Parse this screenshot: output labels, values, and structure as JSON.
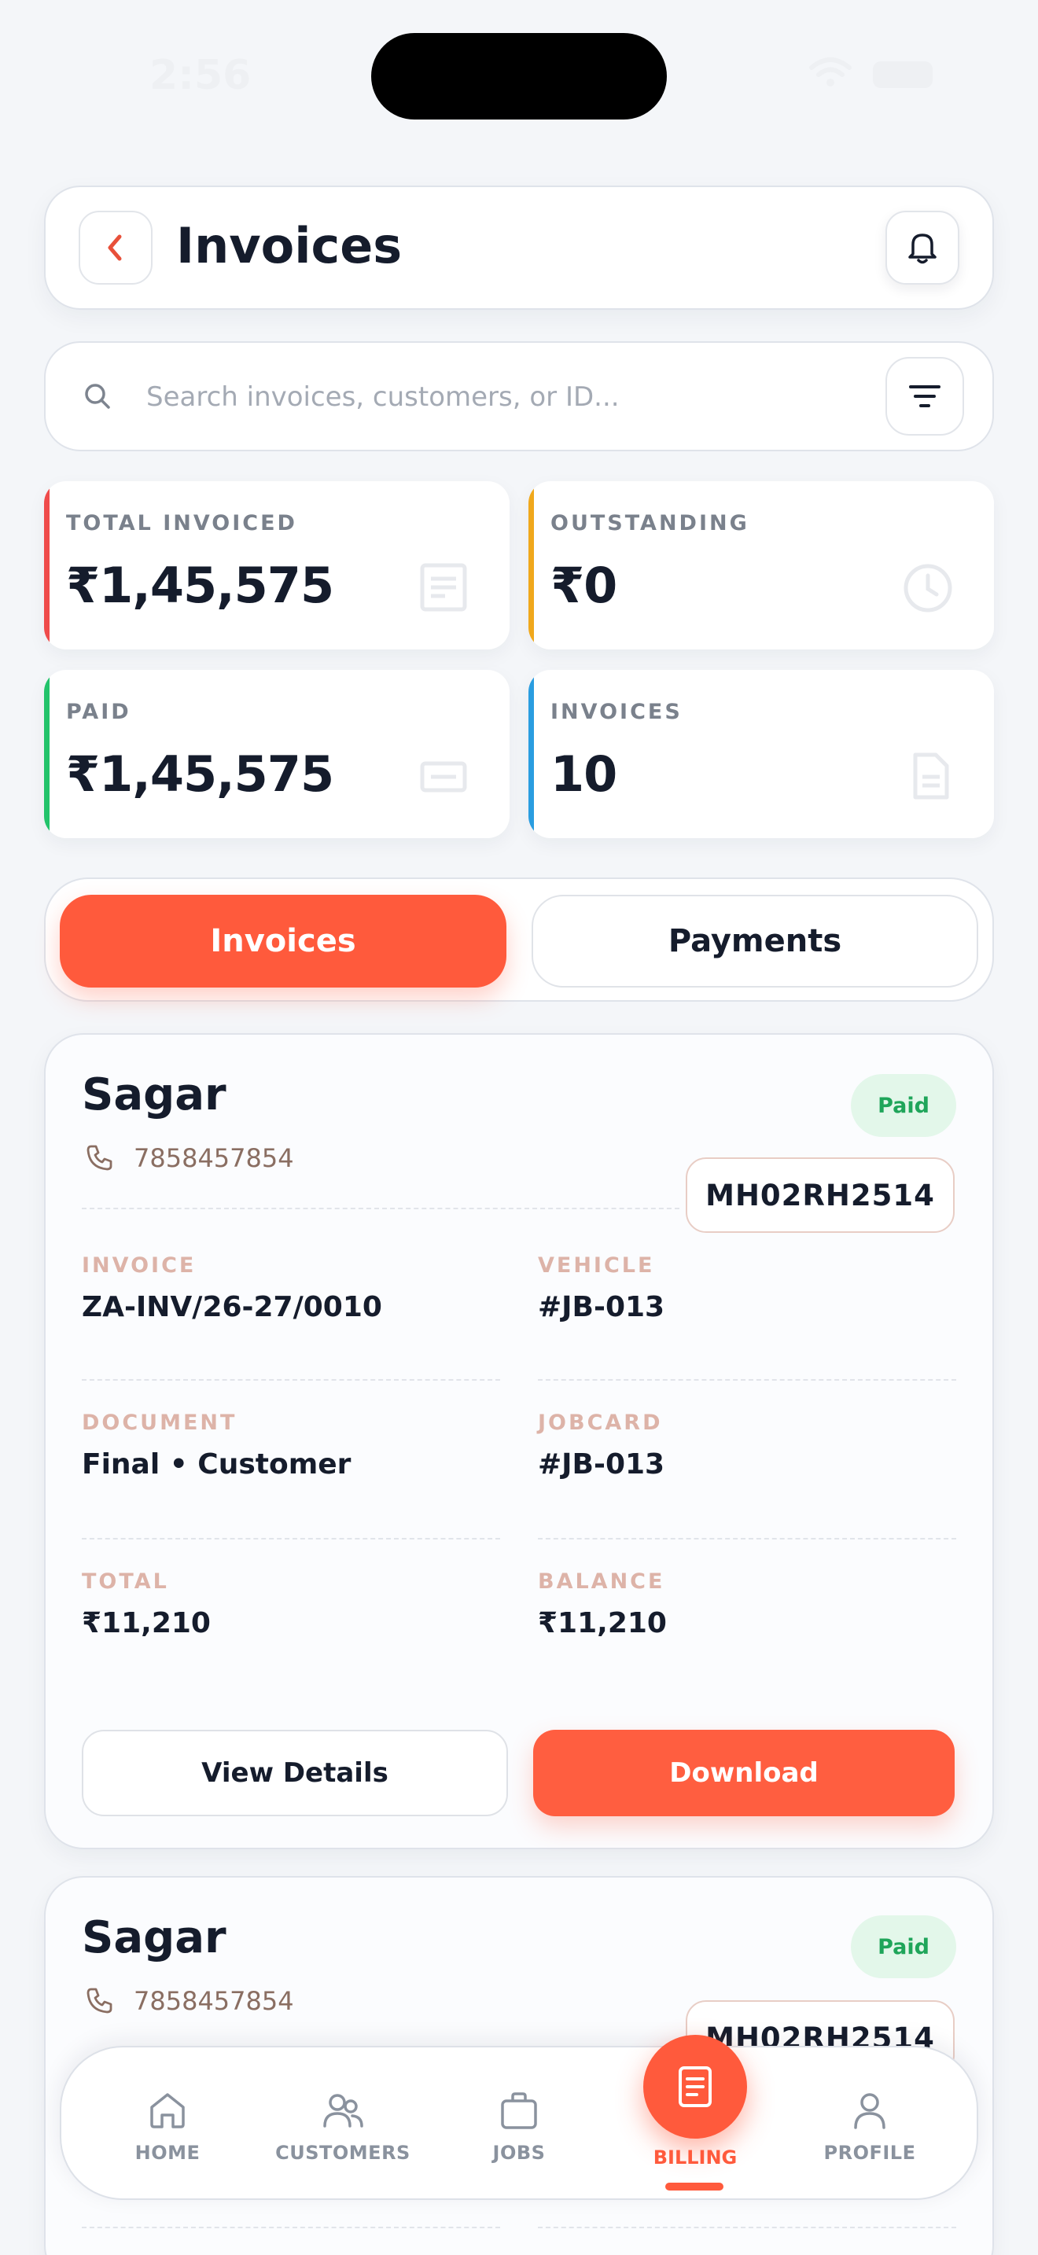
{
  "status_bar": {
    "time": "2:56"
  },
  "header": {
    "title": "Invoices"
  },
  "search": {
    "placeholder": "Search invoices, customers, or ID..."
  },
  "stats": [
    {
      "label": "TOTAL INVOICED",
      "value": "₹1,45,575",
      "accent": "#ef4b4b",
      "icon": "document-lines-icon"
    },
    {
      "label": "OUTSTANDING",
      "value": "₹0",
      "accent": "#f0a81c",
      "icon": "clock-icon"
    },
    {
      "label": "PAID",
      "value": "₹1,45,575",
      "accent": "#22c36b",
      "icon": "card-icon"
    },
    {
      "label": "INVOICES",
      "value": "10",
      "accent": "#2a9de0",
      "icon": "file-icon"
    }
  ],
  "tabs": {
    "active": "Invoices",
    "inactive": "Payments"
  },
  "invoices": [
    {
      "customer": "Sagar",
      "phone": "7858457854",
      "status": "Paid",
      "plate": "MH02RH2514",
      "fields": {
        "invoice_label": "INVOICE",
        "invoice_value": "ZA-INV/26-27/0010",
        "vehicle_label": "VEHICLE",
        "vehicle_value": "#JB-013",
        "document_label": "DOCUMENT",
        "document_value": "Final • Customer",
        "jobcard_label": "JOBCARD",
        "jobcard_value": "#JB-013",
        "total_label": "TOTAL",
        "total_value": "₹11,210",
        "balance_label": "BALANCE",
        "balance_value": "₹11,210"
      },
      "actions": {
        "view": "View Details",
        "download": "Download"
      }
    },
    {
      "customer": "Sagar",
      "phone": "7858457854",
      "status": "Paid",
      "plate": "MH02RH2514"
    }
  ],
  "nav": {
    "home": "HOME",
    "customers": "CUSTOMERS",
    "jobs": "JOBS",
    "billing": "BILLING",
    "profile": "PROFILE"
  },
  "colors": {
    "accent": "#ff5a3c",
    "paid_green": "#1fa55a",
    "text_dark": "#151c2c"
  }
}
